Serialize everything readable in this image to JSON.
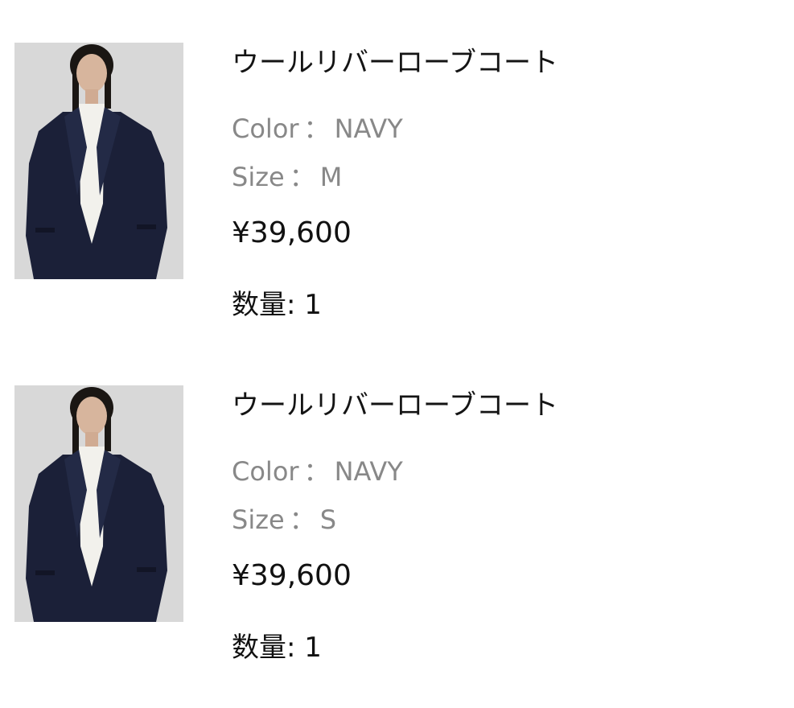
{
  "cart": {
    "items": [
      {
        "name": "ウールリバーローブコート",
        "color_label": "Color",
        "color_sep": "：",
        "color_value": "NAVY",
        "size_label": "Size",
        "size_sep": "：",
        "size_value": "M",
        "price": "¥39,600",
        "qty_label": "数量:",
        "qty_value": "1",
        "image_icon": "product-photo"
      },
      {
        "name": "ウールリバーローブコート",
        "color_label": "Color",
        "color_sep": "：",
        "color_value": "NAVY",
        "size_label": "Size",
        "size_sep": "：",
        "size_value": "S",
        "price": "¥39,600",
        "qty_label": "数量:",
        "qty_value": "1",
        "image_icon": "product-photo"
      }
    ],
    "colors": {
      "text": "#111111",
      "muted": "#888888",
      "photo_bg": "#d6d6d6",
      "coat": "#1b2038",
      "shirt": "#f2f1ec"
    }
  }
}
